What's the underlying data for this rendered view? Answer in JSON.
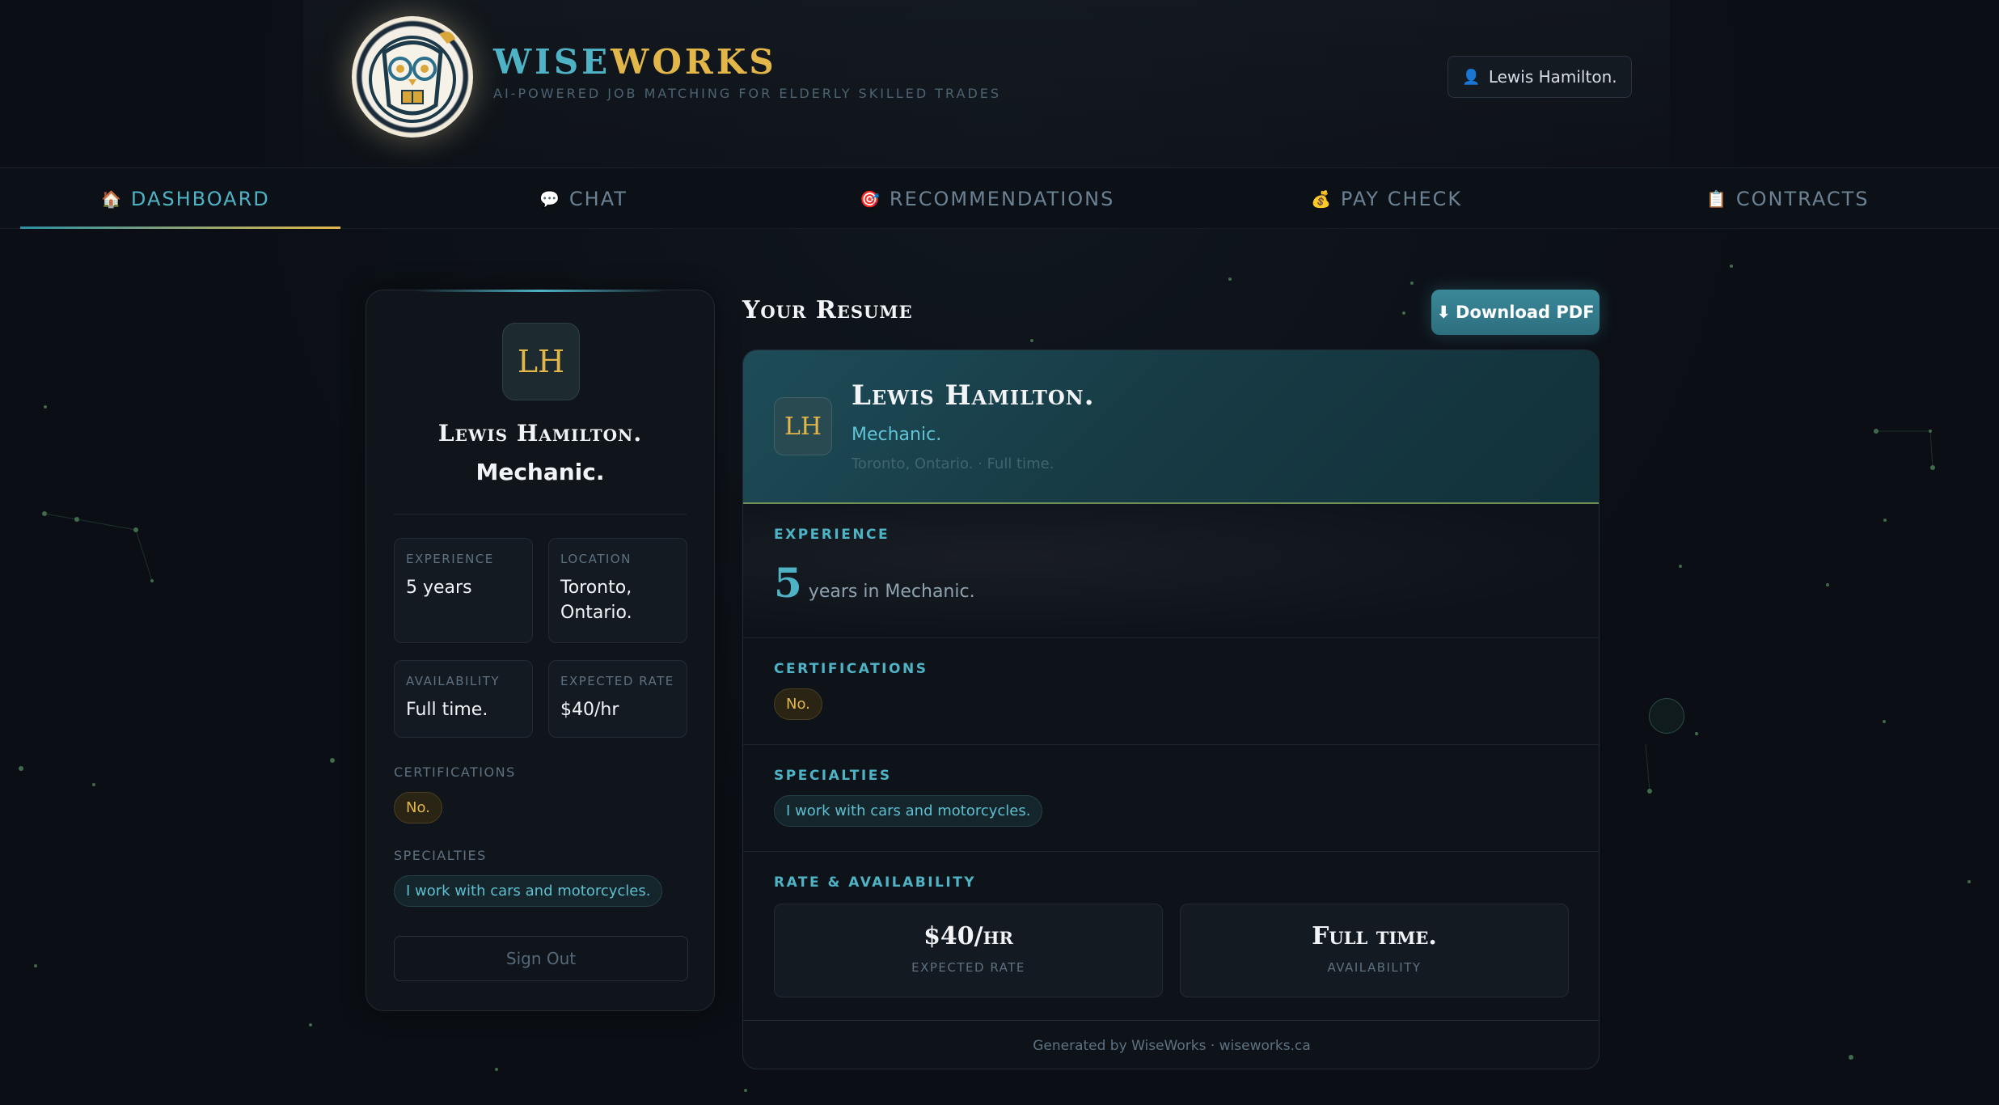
{
  "header": {
    "brand_wise": "WISE",
    "brand_works": "WORKS",
    "tagline": "AI-POWERED JOB MATCHING FOR ELDERLY SKILLED TRADES",
    "user_chip": "Lewis Hamilton.",
    "user_icon": "person-icon"
  },
  "nav": {
    "items": [
      {
        "label": "DASHBOARD",
        "icon": "🏠",
        "active": true
      },
      {
        "label": "CHAT",
        "icon": "💬",
        "active": false
      },
      {
        "label": "RECOMMENDATIONS",
        "icon": "🎯",
        "active": false
      },
      {
        "label": "PAY CHECK",
        "icon": "💰",
        "active": false
      },
      {
        "label": "CONTRACTS",
        "icon": "📋",
        "active": false
      }
    ]
  },
  "profile": {
    "initials": "LH",
    "name": "Lewis Hamilton.",
    "role": "Mechanic.",
    "stats": {
      "experience_label": "EXPERIENCE",
      "experience_value": "5 years",
      "location_label": "LOCATION",
      "location_value": "Toronto, Ontario.",
      "availability_label": "AVAILABILITY",
      "availability_value": "Full time.",
      "rate_label": "EXPECTED RATE",
      "rate_value": "$40/hr"
    },
    "certifications_label": "CERTIFICATIONS",
    "certification": "No.",
    "specialties_label": "SPECIALTIES",
    "specialty": "I work with cars and motorcycles.",
    "sign_out": "Sign Out"
  },
  "resume": {
    "title": "Your Resume",
    "download_label": "Download PDF",
    "download_icon": "⬇",
    "initials": "LH",
    "name": "Lewis Hamilton.",
    "role": "Mechanic.",
    "meta": "Toronto, Ontario. · Full time.",
    "experience_label": "EXPERIENCE",
    "experience_years": "5",
    "experience_text": "years in Mechanic.",
    "certifications_label": "CERTIFICATIONS",
    "certification": "No.",
    "specialties_label": "SPECIALTIES",
    "specialty": "I work with cars and motorcycles.",
    "rate_section_label": "RATE & AVAILABILITY",
    "rate_value": "$40/hr",
    "rate_caption": "EXPECTED RATE",
    "availability_value": "Full time.",
    "availability_caption": "AVAILABILITY",
    "footer": "Generated by WiseWorks · wiseworks.ca"
  },
  "colors": {
    "accent_teal": "#4fb3c6",
    "accent_gold": "#e3b64a",
    "background": "#0b0f15"
  }
}
